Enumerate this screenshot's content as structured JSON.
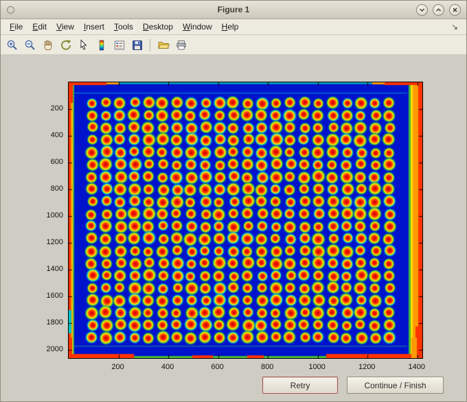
{
  "window": {
    "title": "Figure 1",
    "controls": [
      {
        "name": "shade",
        "glyph": "chevron-down"
      },
      {
        "name": "maximize",
        "glyph": "chevron-up"
      },
      {
        "name": "close",
        "glyph": "x"
      }
    ]
  },
  "menubar": {
    "items": [
      {
        "label": "File"
      },
      {
        "label": "Edit"
      },
      {
        "label": "View"
      },
      {
        "label": "Insert"
      },
      {
        "label": "Tools"
      },
      {
        "label": "Desktop"
      },
      {
        "label": "Window"
      },
      {
        "label": "Help"
      }
    ],
    "dock_arrow": "↘"
  },
  "toolbar": {
    "buttons": [
      {
        "name": "zoom-in"
      },
      {
        "name": "zoom-out"
      },
      {
        "name": "pan"
      },
      {
        "name": "rotate-3d"
      },
      {
        "name": "data-cursor"
      },
      {
        "name": "colorbar"
      },
      {
        "name": "legend"
      },
      {
        "name": "save"
      },
      {
        "name": "open"
      },
      {
        "name": "print"
      }
    ]
  },
  "chart_data": {
    "type": "heatmap",
    "title": "",
    "xlabel": "",
    "ylabel": "",
    "x_ticks": [
      200,
      400,
      600,
      800,
      1000,
      1200,
      1400
    ],
    "y_ticks": [
      200,
      400,
      600,
      800,
      1000,
      1200,
      1400,
      1600,
      1800,
      2000
    ],
    "x_range": [
      0,
      1420
    ],
    "y_range": [
      0,
      2060
    ],
    "grid": {
      "rows": 20,
      "cols": 22
    },
    "colormap": "jet",
    "palette": {
      "background_blue": "#0013cc",
      "spot_core": "#cc0000",
      "spot_hot": "#ff2a00",
      "spot_mid": "#ff8800",
      "spot_ring": "#ffee00",
      "spot_halo": "#3ecc3a",
      "spot_halo_alt": "#00c8c8",
      "edge_red": "#ff3300",
      "edge_orange": "#ff9900",
      "edge_yellow": "#ffe000",
      "edge_green": "#44bb33",
      "edge_teal": "#00a8b8",
      "edge_cyan": "#00c8c8"
    },
    "description": "Microarray plate scan displayed with jet colormap: dark blue field containing a 22x20 grid of spots with red cores and yellow-green halos; saturated red/orange bands along the image edges."
  },
  "action_buttons": {
    "retry": "Retry",
    "continue_finish": "Continue / Finish"
  }
}
